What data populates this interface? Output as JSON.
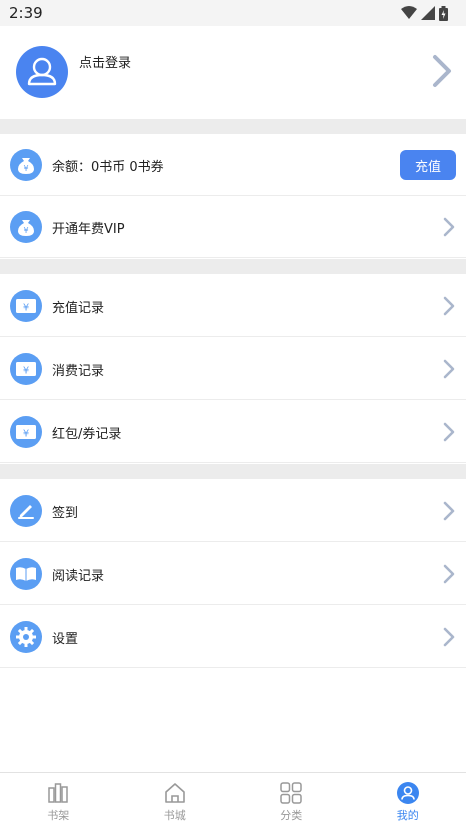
{
  "status_bar": {
    "time": "2:39"
  },
  "profile": {
    "login_text": "点击登录"
  },
  "account": {
    "balance_text": "余额：0书币  0书券",
    "recharge_label": "充值",
    "vip_label": "开通年费VIP"
  },
  "records": [
    {
      "label": "充值记录"
    },
    {
      "label": "消费记录"
    },
    {
      "label": "红包/券记录"
    }
  ],
  "misc": [
    {
      "label": "签到"
    },
    {
      "label": "阅读记录"
    },
    {
      "label": "设置"
    }
  ],
  "tabbar": {
    "tabs": [
      {
        "label": "书架",
        "icon": "bookshelf-icon"
      },
      {
        "label": "书城",
        "icon": "home-icon"
      },
      {
        "label": "分类",
        "icon": "category-icon"
      },
      {
        "label": "我的",
        "icon": "profile-icon",
        "active": true
      }
    ]
  },
  "colors": {
    "accent": "#4a84f0",
    "icon_bg": "#5b9ef3",
    "divider": "#ececec"
  }
}
